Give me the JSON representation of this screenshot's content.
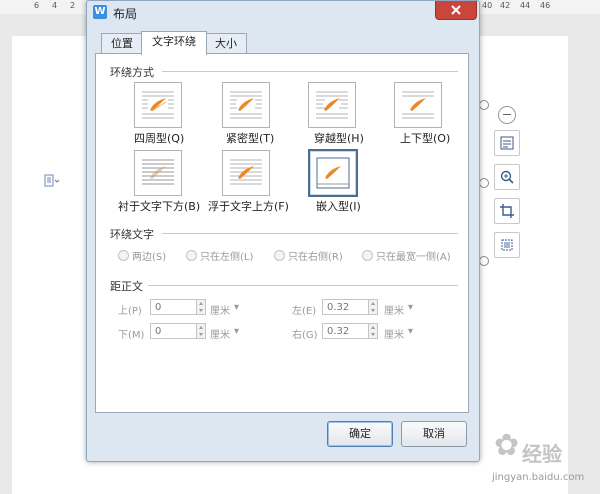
{
  "ruler": {
    "left": [
      "6",
      "4",
      "2"
    ],
    "right": [
      "40",
      "42",
      "44",
      "46"
    ]
  },
  "dialog": {
    "title": "布局",
    "tabs": [
      {
        "label": "位置"
      },
      {
        "label": "文字环绕"
      },
      {
        "label": "大小"
      }
    ],
    "wrap_section": {
      "title": "环绕方式",
      "options": [
        {
          "label": "四周型(Q)"
        },
        {
          "label": "紧密型(T)"
        },
        {
          "label": "穿越型(H)"
        },
        {
          "label": "上下型(O)"
        },
        {
          "label": "衬于文字下方(B)"
        },
        {
          "label": "浮于文字上方(F)"
        },
        {
          "label": "嵌入型(I)"
        }
      ],
      "selected": "嵌入型(I)"
    },
    "wrap_text": {
      "title": "环绕文字",
      "options": [
        {
          "label": "两边(S)"
        },
        {
          "label": "只在左侧(L)"
        },
        {
          "label": "只在右侧(R)"
        },
        {
          "label": "只在最宽一侧(A)"
        }
      ]
    },
    "distance": {
      "title": "距正文",
      "top": {
        "label": "上(P)",
        "value": "0",
        "unit": "厘米"
      },
      "bottom": {
        "label": "下(M)",
        "value": "0",
        "unit": "厘米"
      },
      "left": {
        "label": "左(E)",
        "value": "0.32",
        "unit": "厘米"
      },
      "right": {
        "label": "右(G)",
        "value": "0.32",
        "unit": "厘米"
      }
    },
    "buttons": {
      "ok": "确定",
      "cancel": "取消"
    }
  },
  "watermark": {
    "text": "经验",
    "url": "jingyan.baidu.com"
  },
  "icons": {
    "app": "wps-w-icon",
    "close": "close-icon"
  },
  "colors": {
    "close_red": "#c9463d",
    "accent_blue": "#4d6d90"
  }
}
